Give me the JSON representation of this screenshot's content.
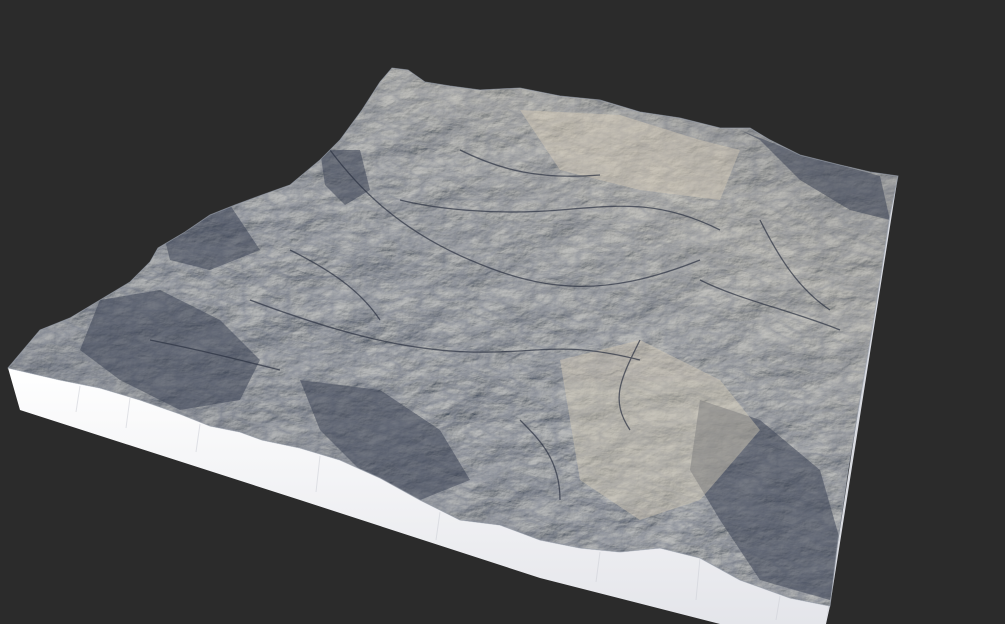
{
  "viewport": {
    "background_color": "#2b2b2b"
  },
  "terrain": {
    "surface_light_color": "#c9c3b3",
    "surface_mid_color": "#8f96a3",
    "surface_shadow_color": "#3f4656",
    "base_side_color": "#f2f2f4",
    "base_side_shadow_color": "#d4d6dc"
  }
}
